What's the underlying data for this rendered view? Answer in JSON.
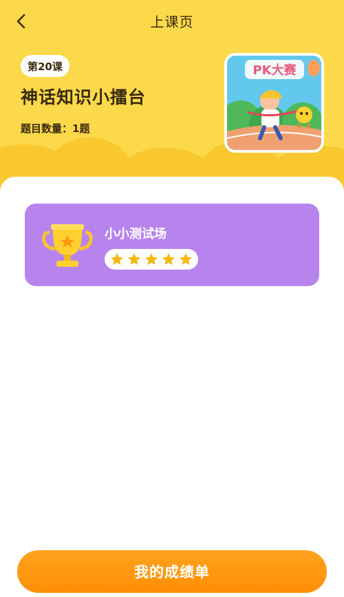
{
  "nav": {
    "title": "上课页",
    "back_icon": "chevron-left-icon"
  },
  "lesson": {
    "badge": "第20课",
    "title": "神话知识小擂台",
    "question_count": "题目数量：1题",
    "cover_label": "PK大赛"
  },
  "quiz_card": {
    "title": "小小测试场",
    "icon": "trophy-icon",
    "stars_filled": 5,
    "stars_total": 5
  },
  "footer": {
    "button_label": "我的成绩单"
  },
  "colors": {
    "header_yellow": "#fcd94a",
    "card_purple": "#b784ee",
    "button_orange": "#ff9a10",
    "star_gold": "#f5b813",
    "text_dark": "#3a2a10"
  }
}
